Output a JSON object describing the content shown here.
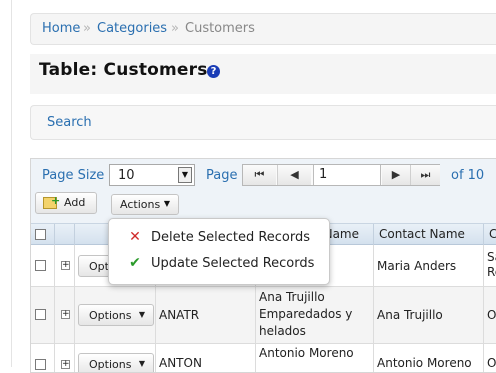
{
  "breadcrumb": {
    "home": "Home",
    "sep1": "»",
    "categories": "Categories",
    "sep2": "»",
    "current": "Customers"
  },
  "page_title": "Table: Customers",
  "help_icon_glyph": "?",
  "search_link": "Search",
  "toolbar": {
    "page_size_label": "Page Size",
    "page_size_value": "10",
    "page_label": "Page",
    "page_value": "1",
    "of_pages": "of 10",
    "add_label": "Add",
    "actions_label": "Actions",
    "caret": "▼"
  },
  "grid": {
    "headers": {
      "company_tail": "Name",
      "contact_name": "Contact Name",
      "next_col": "Co"
    },
    "option_label": "Options",
    "option_label_partial": "Opti",
    "plus_glyph": "+",
    "rows": [
      {
        "contact": "Maria Anders",
        "extra_line1": "Sa",
        "extra_line2": "Re"
      },
      {
        "id": "ANATR",
        "company": [
          "Ana Trujillo",
          "Emparedados y",
          "helados"
        ],
        "contact": "Ana Trujillo",
        "extra": "O"
      },
      {
        "id": "ANTON",
        "company": "Antonio Moreno",
        "contact": "Antonio Moreno",
        "extra": "O"
      }
    ]
  },
  "actions_menu": {
    "items": [
      {
        "label": "Delete Selected Records",
        "icon": "delete-x-icon"
      },
      {
        "label": "Update Selected Records",
        "icon": "check-icon"
      }
    ]
  },
  "colors": {
    "link": "#2a6fb0",
    "help_icon_bg": "#1a3db6",
    "delete_icon": "#d02a2a",
    "update_icon": "#2b9a2b"
  }
}
